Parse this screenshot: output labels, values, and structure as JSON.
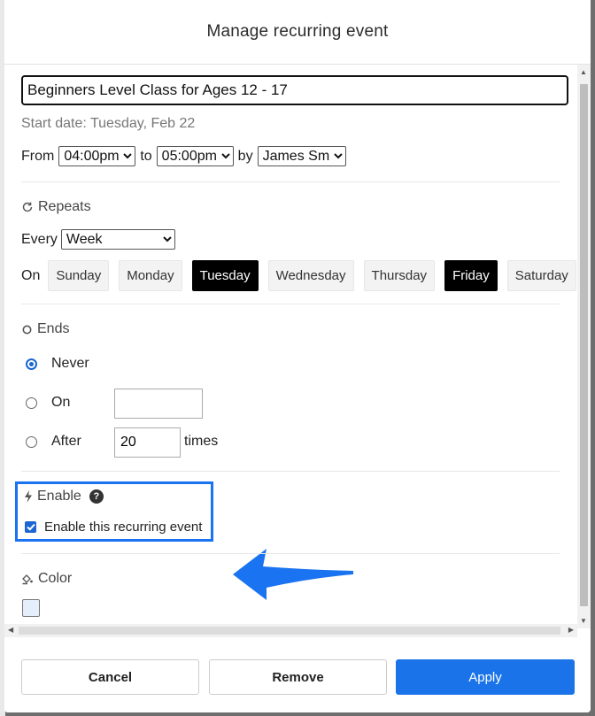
{
  "modal": {
    "title": "Manage recurring event"
  },
  "event": {
    "title_value": "Beginners Level Class for Ages 12 - 17",
    "start_date": "Start date: Tuesday, Feb 22",
    "from_label": "From",
    "from_time": "04:00pm",
    "to_label": "to",
    "to_time": "05:00pm",
    "by_label": "by",
    "by_user": "James Sm"
  },
  "repeats": {
    "label": "Repeats",
    "every_label": "Every",
    "every_value": "Week",
    "on_label": "On",
    "days": [
      {
        "label": "Sunday",
        "active": false
      },
      {
        "label": "Monday",
        "active": false
      },
      {
        "label": "Tuesday",
        "active": true
      },
      {
        "label": "Wednesday",
        "active": false
      },
      {
        "label": "Thursday",
        "active": false
      },
      {
        "label": "Friday",
        "active": true
      },
      {
        "label": "Saturday",
        "active": false
      }
    ]
  },
  "ends": {
    "label": "Ends",
    "never_label": "Never",
    "on_label": "On",
    "on_value": "",
    "after_label": "After",
    "after_value": "20",
    "times_label": "times",
    "selected": "never"
  },
  "enable": {
    "label": "Enable",
    "help": "?",
    "checkbox_label": "Enable this recurring event",
    "checked": true
  },
  "color": {
    "label": "Color",
    "value": "#e5eefb"
  },
  "footer": {
    "cancel_label": "Cancel",
    "remove_label": "Remove",
    "apply_label": "Apply"
  },
  "colors": {
    "accent": "#1a73e8",
    "highlight": "#1a73f0",
    "active_day": "#000000"
  }
}
